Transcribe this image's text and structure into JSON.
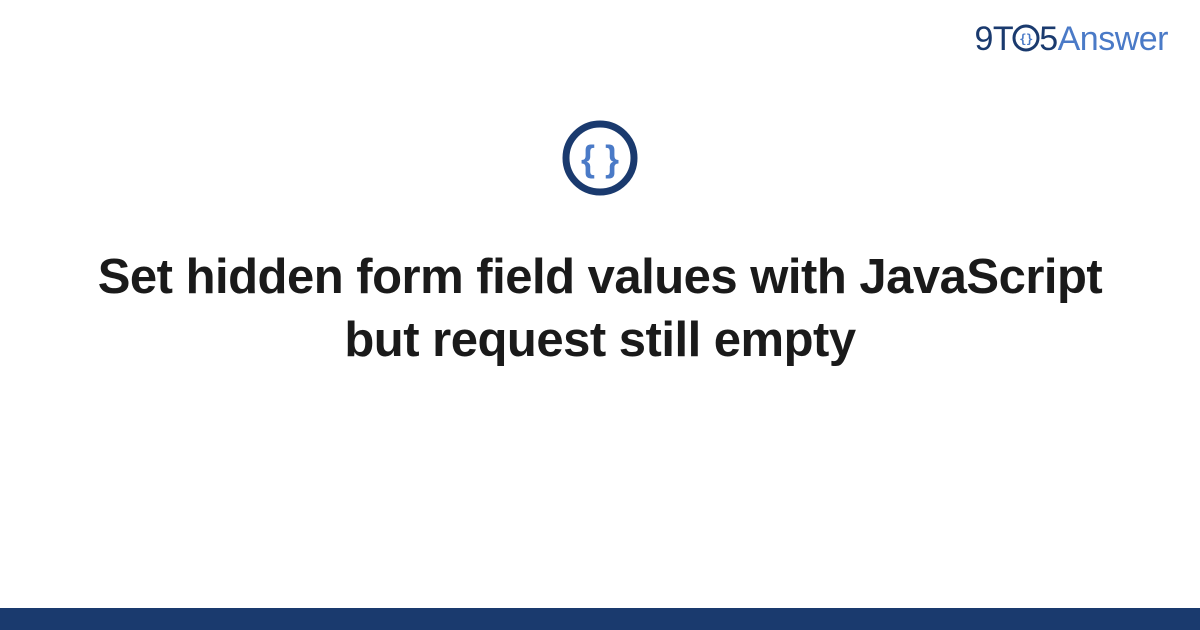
{
  "brand": {
    "part1": "9",
    "part2": "T",
    "part4": "5",
    "part5": "Answer"
  },
  "icon": {
    "name": "code-braces-icon"
  },
  "title": "Set hidden form field values with JavaScript but request still empty",
  "colors": {
    "dark_blue": "#1a3a6e",
    "light_blue": "#4a7ac7",
    "text": "#1a1a1a"
  }
}
